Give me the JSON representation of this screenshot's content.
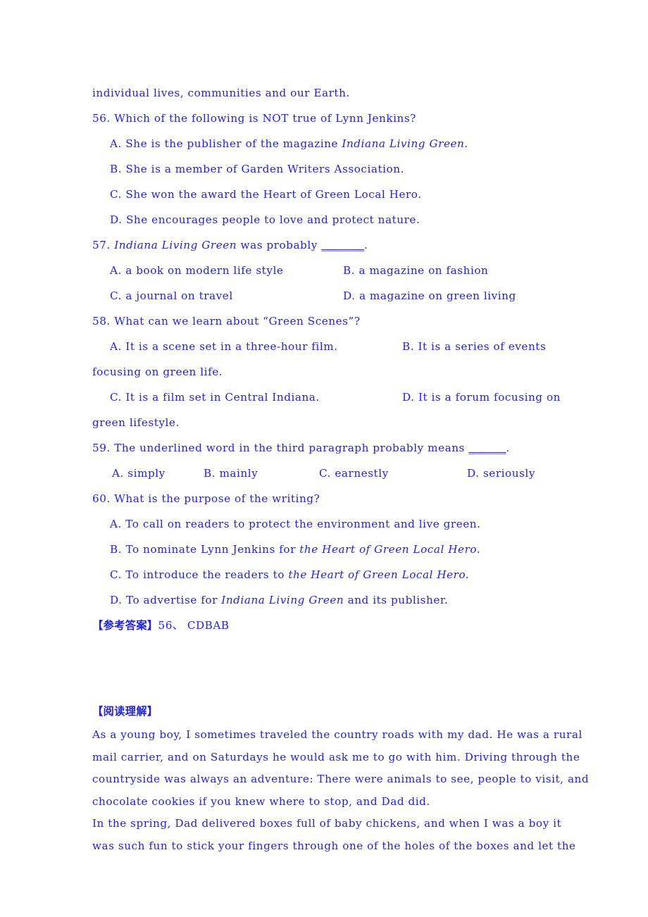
{
  "document": {
    "text_color": "#2222dd",
    "background_color": "#ffffff",
    "continuation_line": "individual lives, communities and our Earth."
  },
  "questions": [
    {
      "number": "56.",
      "stem": "Which of the following is NOT true of Lynn Jenkins?",
      "options": [
        {
          "label": "A.",
          "pre": "She is the publisher of the magazine ",
          "italic": "Indiana Living Green",
          "post": "."
        },
        {
          "label": "B.",
          "pre": "She is a member of Garden Writers Association.",
          "italic": "",
          "post": ""
        },
        {
          "label": "C.",
          "pre": "She won the award the Heart of Green Local Hero.",
          "italic": "",
          "post": ""
        },
        {
          "label": "D.",
          "pre": "She encourages people to love and protect nature.",
          "italic": "",
          "post": ""
        }
      ]
    },
    {
      "number": "57.",
      "stem_italic": "Indiana Living Green",
      "stem_rest": " was probably ",
      "stem_blank": "________",
      "stem_end": ".",
      "options_grid": [
        {
          "a": "A. a book on modern life style",
          "b": "B. a magazine on fashion"
        },
        {
          "a": "C. a journal on travel",
          "b": "D. a magazine on green living"
        }
      ]
    },
    {
      "number": "58.",
      "stem": "What can we learn about “Green Scenes”?",
      "row1_a": "A. It is a scene set in a three-hour film.",
      "row1_b": "B. It is a series of events",
      "row1_wrap": "focusing on green life.",
      "row2_c": "C. It is a film set in Central Indiana.",
      "row2_d": "D. It is a forum focusing on",
      "row2_wrap": "green lifestyle."
    },
    {
      "number": "59.",
      "stem_pre": "The underlined word in the third paragraph probably means ",
      "stem_blank": "_______",
      "stem_end": ".",
      "options_inline": [
        "A. simply",
        "B. mainly",
        "C. earnestly",
        "D. seriously"
      ]
    },
    {
      "number": "60.",
      "stem": "What is the purpose of the writing?",
      "options": [
        {
          "label": "A.",
          "pre": "To call on readers to protect the environment and live green.",
          "italic": "",
          "post": ""
        },
        {
          "label": "B.",
          "pre": "To nominate Lynn Jenkins for ",
          "italic": "the Heart of Green Local Hero",
          "post": "."
        },
        {
          "label": "C.",
          "pre": "To introduce the readers to ",
          "italic": "the Heart of Green Local Hero",
          "post": "."
        },
        {
          "label": "D.",
          "pre": "To advertise for ",
          "italic": "Indiana Living Green",
          "post": " and its publisher."
        }
      ]
    }
  ],
  "answer_key": {
    "heading": "【参考答案】",
    "body": "56、 CDBAB"
  },
  "reading_section": {
    "heading": "【阅读理解】",
    "paragraphs": [
      [
        "As a young boy, I sometimes traveled the country roads with my dad. He was a rural",
        "mail carrier, and on Saturdays he would ask me to go with him. Driving through the",
        "countryside was always an adventure: There were animals to see, people to visit, and",
        "chocolate cookies if you knew where to stop, and Dad did."
      ],
      [
        "In the spring, Dad delivered boxes full of baby chickens, and when I was a boy it",
        "was such fun to stick your fingers through one of the holes of the boxes and let the"
      ]
    ]
  }
}
